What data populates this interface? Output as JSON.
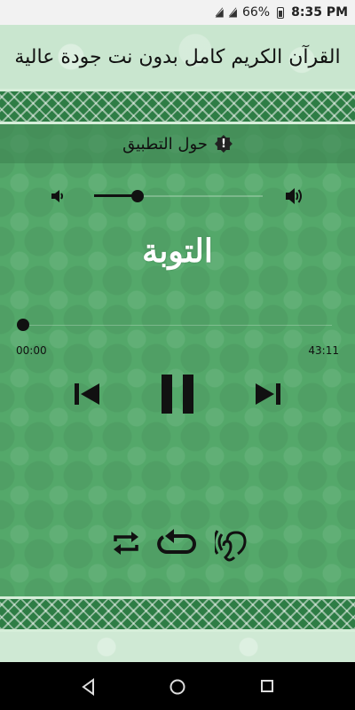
{
  "status_bar": {
    "battery_percent": "66%",
    "time": "8:35 PM",
    "icons": [
      "signal-x-icon",
      "wifi-x-icon",
      "battery-icon"
    ]
  },
  "header": {
    "title": "القرآن الكريم كامل بدون نت جودة عالية"
  },
  "about": {
    "label": "حول التطبيق",
    "icon": "info-badge-icon"
  },
  "player": {
    "surah_name": "التوبة",
    "volume_level": 0.26,
    "progress": 0,
    "time_elapsed": "00:00",
    "time_total": "43:11"
  },
  "controls": [
    "skip-previous-icon",
    "pause-icon",
    "skip-next-icon"
  ],
  "modes": [
    "repeat-icon",
    "loop-once-icon",
    "ear-icon"
  ],
  "nav": [
    "back-icon",
    "home-icon",
    "recent-apps-icon"
  ],
  "colors": {
    "background_green": "#54a86a",
    "header_light": "#c9e6cf",
    "band_green": "#2e7d45"
  }
}
